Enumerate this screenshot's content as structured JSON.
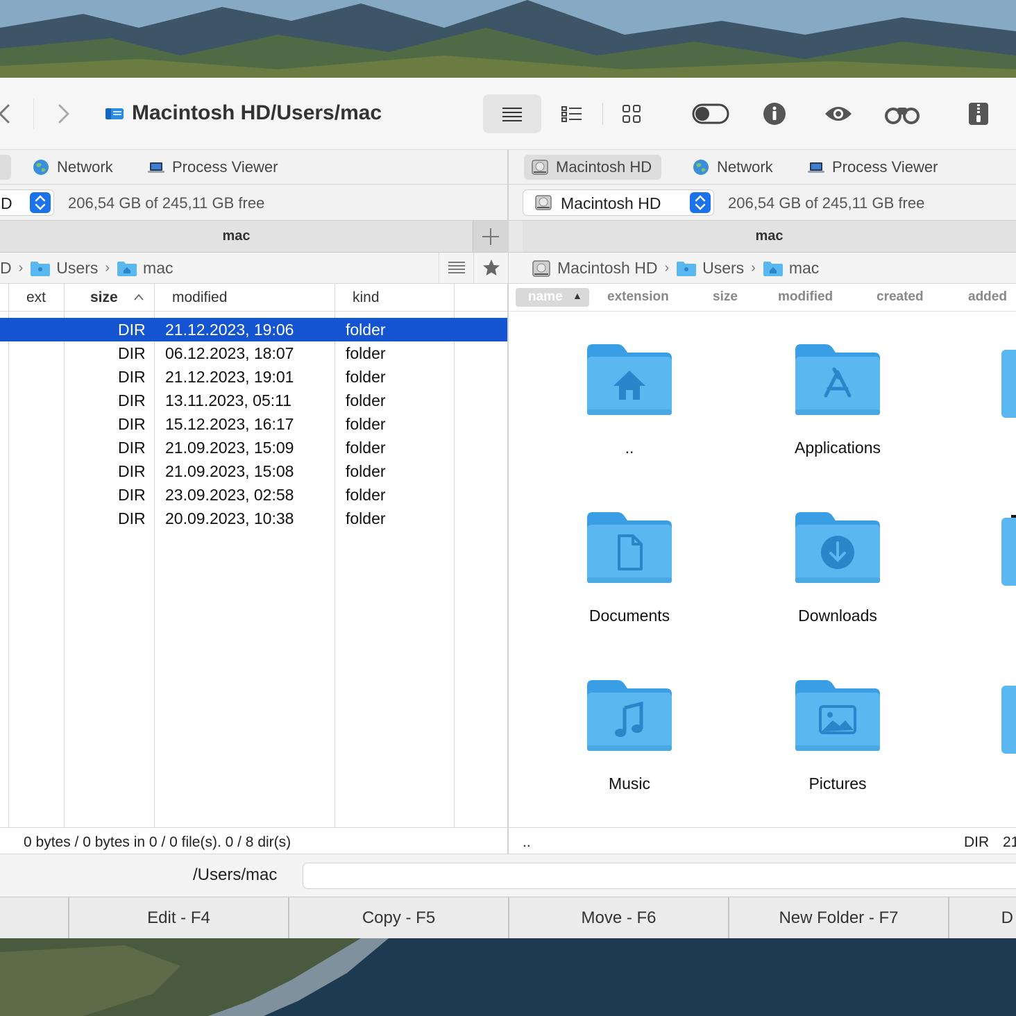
{
  "toolbar": {
    "path_title": "Macintosh HD/Users/mac"
  },
  "left": {
    "tabs": [
      "Network",
      "Process Viewer"
    ],
    "drive_fragment": "D",
    "free_space": "206,54 GB of 245,11 GB free",
    "pane_title": "mac",
    "breadcrumb": {
      "drive_fragment": "D",
      "users": "Users",
      "mac": "mac"
    },
    "columns": {
      "ext": "ext",
      "size": "size",
      "modified": "modified",
      "kind": "kind"
    },
    "rows": [
      {
        "size": "DIR",
        "modified": "21.12.2023, 19:06",
        "kind": "folder",
        "selected": true
      },
      {
        "size": "DIR",
        "modified": "06.12.2023, 18:07",
        "kind": "folder"
      },
      {
        "size": "DIR",
        "modified": "21.12.2023, 19:01",
        "kind": "folder"
      },
      {
        "size": "DIR",
        "modified": "13.11.2023, 05:11",
        "kind": "folder"
      },
      {
        "size": "DIR",
        "modified": "15.12.2023, 16:17",
        "kind": "folder"
      },
      {
        "size": "DIR",
        "modified": "21.09.2023, 15:09",
        "kind": "folder"
      },
      {
        "size": "DIR",
        "modified": "21.09.2023, 15:08",
        "kind": "folder"
      },
      {
        "size": "DIR",
        "modified": "23.09.2023, 02:58",
        "kind": "folder"
      },
      {
        "size": "DIR",
        "modified": "20.09.2023, 10:38",
        "kind": "folder"
      }
    ],
    "status": "0 bytes / 0 bytes in 0 / 0 file(s). 0 / 8 dir(s)"
  },
  "right": {
    "tabs": [
      "Macintosh HD",
      "Network",
      "Process Viewer"
    ],
    "drive": "Macintosh HD",
    "free_space": "206,54 GB of 245,11 GB free",
    "pane_title": "mac",
    "breadcrumb": {
      "drive": "Macintosh HD",
      "users": "Users",
      "mac": "mac"
    },
    "columns": {
      "name": "name",
      "extension": "extension",
      "size": "size",
      "modified": "modified",
      "created": "created",
      "added": "added"
    },
    "items": [
      {
        "label": "..",
        "icon": "home-glyph"
      },
      {
        "label": "Applications",
        "icon": "apps-glyph"
      },
      {
        "label": "Documents",
        "icon": "doc-glyph"
      },
      {
        "label": "Downloads",
        "icon": "download-glyph"
      },
      {
        "label": "Music",
        "icon": "music-glyph"
      },
      {
        "label": "Pictures",
        "icon": "picture-glyph"
      }
    ],
    "status_name": "..",
    "status_size": "DIR",
    "status_date_fragment": "21"
  },
  "command": {
    "path": "/Users/mac",
    "input_value": ""
  },
  "fkeys": [
    "Edit - F4",
    "Copy - F5",
    "Move - F6",
    "New Folder - F7",
    "D"
  ],
  "colors": {
    "selection": "#1554d1",
    "folder": "#5bb7ef",
    "accent": "#1a73e8"
  }
}
